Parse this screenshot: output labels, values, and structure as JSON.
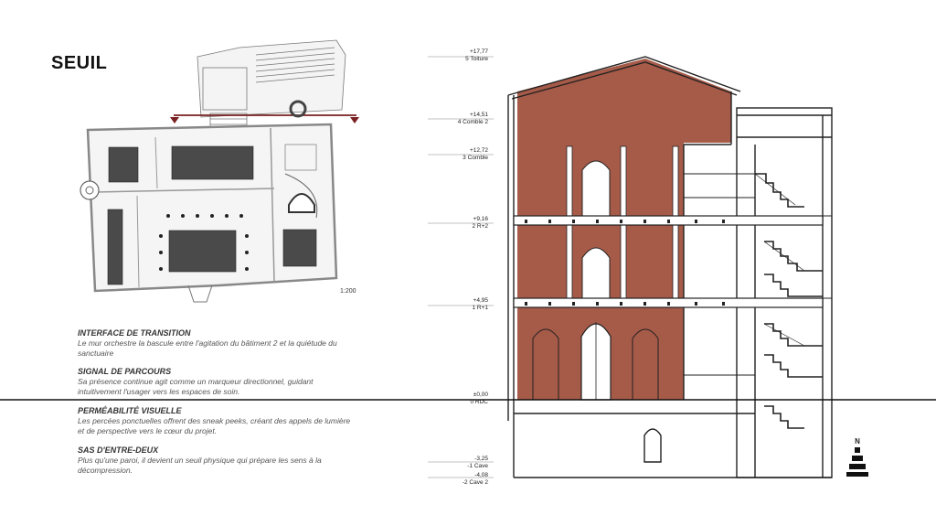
{
  "title": "SEUIL",
  "plan": {
    "scale": "1:200"
  },
  "blocks": [
    {
      "heading": "INTERFACE DE TRANSITION",
      "body": "Le mur orchestre la bascule entre l'agitation du bâtiment 2 et la quiétude du sanctuaire"
    },
    {
      "heading": "SIGNAL DE PARCOURS",
      "body": "Sa présence continue agit comme un marqueur directionnel, guidant intuitivement l'usager vers les espaces de soin."
    },
    {
      "heading": "PERMÉABILITÉ VISUELLE",
      "body": "Les percées ponctuelles offrent des sneak peeks, créant des appels de lumière et de perspective vers le cœur du projet."
    },
    {
      "heading": "SAS D'ENTRE-DEUX",
      "body": "Plus qu'une paroi, il devient un seuil physique qui prépare les sens à la décompression."
    }
  ],
  "levels": [
    {
      "elevation": "+17,77",
      "name": "5 Toiture"
    },
    {
      "elevation": "+14,51",
      "name": "4 Comble 2"
    },
    {
      "elevation": "+12,72",
      "name": "3 Comble"
    },
    {
      "elevation": "+9,16",
      "name": "2 R+2"
    },
    {
      "elevation": "+4,95",
      "name": "1 R+1"
    },
    {
      "elevation": "±0,00",
      "name": "0 RDC"
    },
    {
      "elevation": "-3,25",
      "name": "-1 Cave"
    },
    {
      "elevation": "-4,08",
      "name": "-2 Cave 2"
    }
  ],
  "north": "N",
  "colors": {
    "wall": "#a65a48",
    "line": "#222222",
    "cut": "#7a2020",
    "dark": "#3a3a3a"
  }
}
